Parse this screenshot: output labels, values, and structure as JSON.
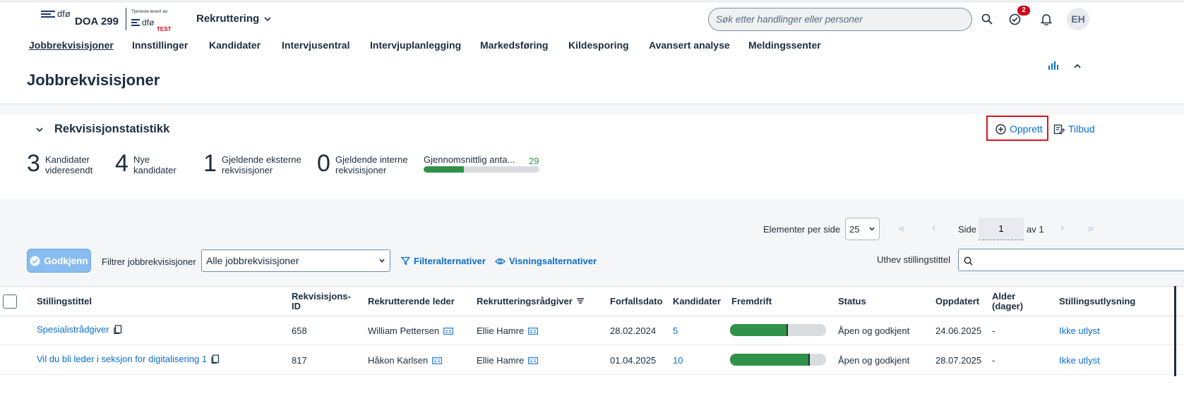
{
  "shell": {
    "dfo_text": "dfø",
    "brand": "DOA 299",
    "tjeneste": "Tjeneste levert av",
    "test": "TEST",
    "app_menu": "Rekruttering",
    "search_placeholder": "Søk etter handlinger eller personer",
    "notification_count": "2",
    "avatar": "EH"
  },
  "nav": [
    {
      "label": "Jobbrekvisisjoner",
      "active": true
    },
    {
      "label": "Innstillinger"
    },
    {
      "label": "Kandidater"
    },
    {
      "label": "Intervjusentral"
    },
    {
      "label": "Intervjuplanlegging"
    },
    {
      "label": "Markedsføring"
    },
    {
      "label": "Kildesporing"
    },
    {
      "label": "Avansert analyse"
    },
    {
      "label": "Meldingssenter"
    }
  ],
  "page_title": "Jobbrekvisisjoner",
  "stats": {
    "title": "Rekvisisjonstatistikk",
    "kpis": [
      {
        "value": "3",
        "label1": "Kandidater",
        "label2": "videresendt"
      },
      {
        "value": "4",
        "label1": "Nye",
        "label2": "kandidater"
      },
      {
        "value": "1",
        "label1": "Gjeldende eksterne",
        "label2": "rekvisisjoner"
      },
      {
        "value": "0",
        "label1": "Gjeldende interne",
        "label2": "rekvisisjoner"
      }
    ],
    "avg_label": "Gjennomsnittlig anta...",
    "avg_value": "29",
    "avg_fraction": 0.35,
    "create_label": "Opprett",
    "offer_label": "Tilbud"
  },
  "toolbar": {
    "per_page_label": "Elementer per side",
    "per_page_value": "25",
    "page_label": "Side",
    "page_value": "1",
    "page_total": "av 1",
    "approve_label": "Godkjenn",
    "filter_label": "Filtrer jobbrekvisisjoner",
    "filter_value": "Alle jobbrekvisisjoner",
    "filter_options_label": "Filteralternativer",
    "view_options_label": "Visningsalternativer",
    "highlight_label": "Uthev stillingstittel"
  },
  "table": {
    "headers": {
      "title": "Stillingstittel",
      "req_id_1": "Rekvisisjons-",
      "req_id_2": "ID",
      "manager": "Rekrutterende leder",
      "advisor": "Rekrutteringsrådgiver",
      "due": "Forfallsdato",
      "candidates": "Kandidater",
      "progress": "Fremdrift",
      "status": "Status",
      "updated": "Oppdatert",
      "age_1": "Alder",
      "age_2": "(dager)",
      "posting": "Stillingsutlysning"
    },
    "rows": [
      {
        "title": "Spesialistrådgiver",
        "id": "658",
        "manager": "William Pettersen",
        "advisor": "Ellie Hamre",
        "due": "28.02.2024",
        "candidates": "5",
        "progress": 0.6,
        "status": "Åpen og godkjent",
        "updated": "24.06.2025",
        "age": "-",
        "posting": "Ikke utlyst"
      },
      {
        "title": "Vil du bli leder i seksjon for digitalisering 1",
        "id": "817",
        "manager": "Håkon Karlsen",
        "advisor": "Ellie Hamre",
        "due": "01.04.2025",
        "candidates": "10",
        "progress": 0.83,
        "status": "Åpen og godkjent",
        "updated": "28.07.2025",
        "age": "-",
        "posting": "Ikke utlyst"
      }
    ]
  },
  "colors": {
    "accent": "#0a6ed1",
    "progress": "#2f9248",
    "highlight": "#e0121f"
  }
}
